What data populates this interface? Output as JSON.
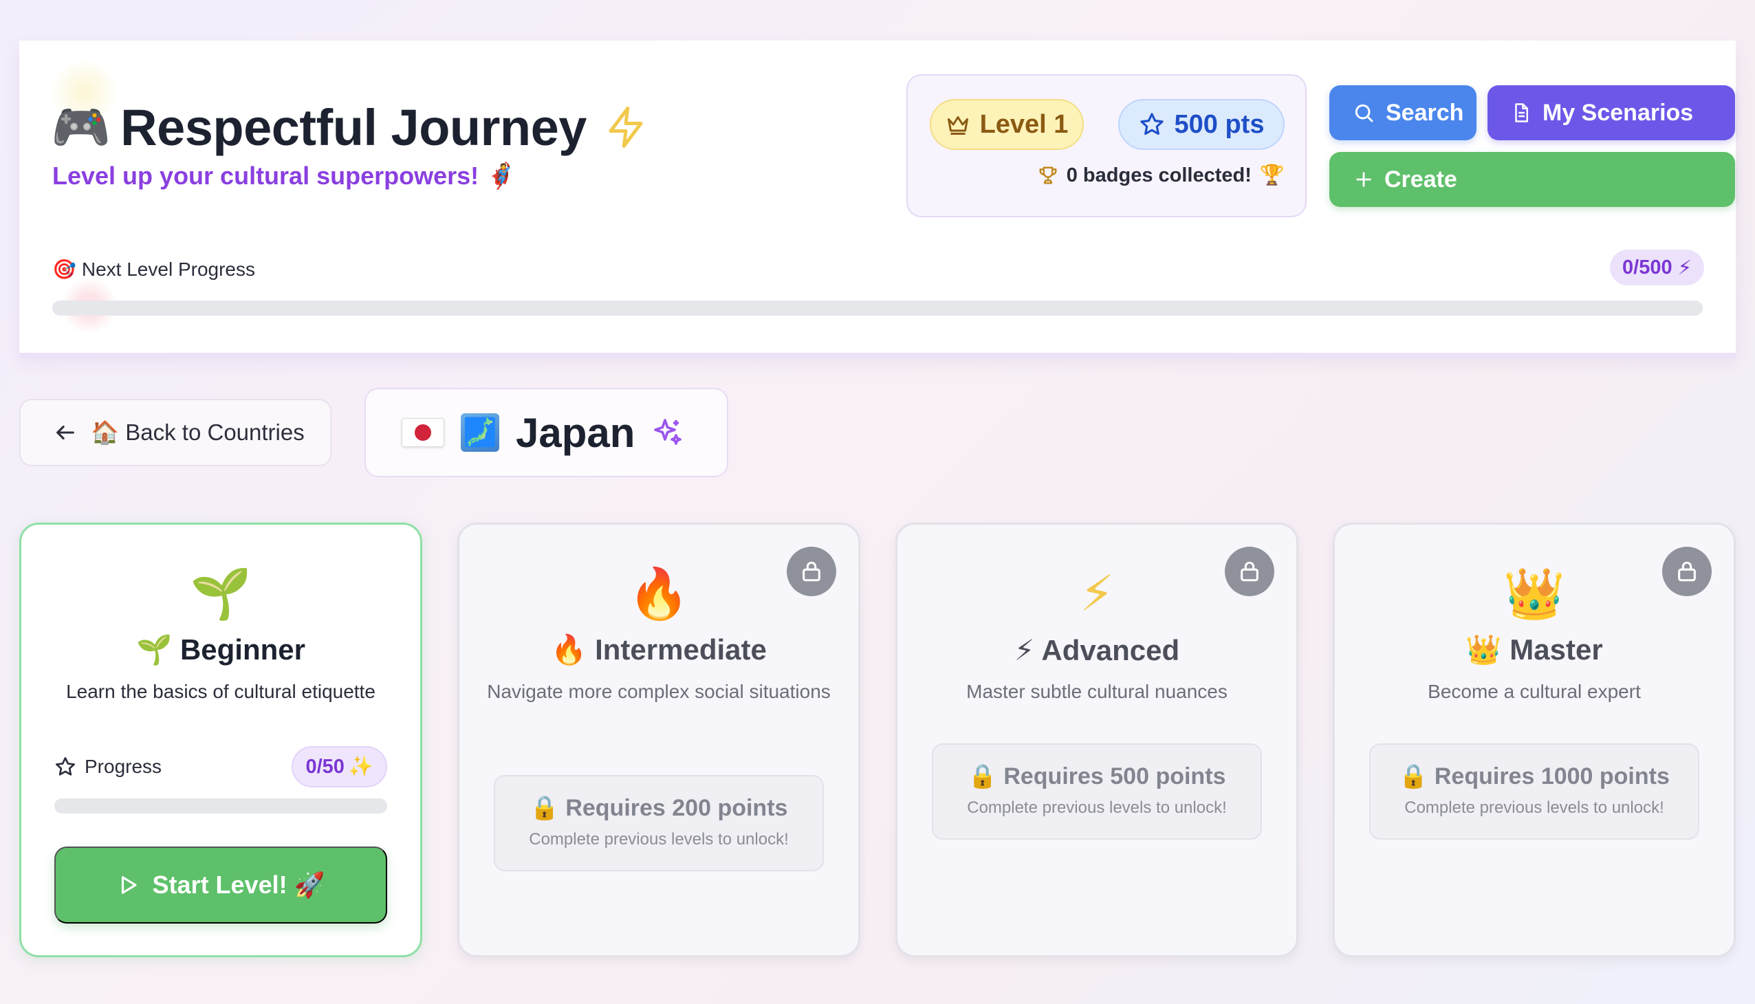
{
  "header": {
    "title_emoji": "🎮",
    "title": "Respectful Journey",
    "subtitle": "Level up your cultural superpowers!",
    "subtitle_emoji": "🦸",
    "level_label": "Level 1",
    "points_label": "500 pts",
    "badges_text": "0 badges collected!",
    "badges_emoji": "🏆",
    "buttons": {
      "search": "Search",
      "scenarios": "My Scenarios",
      "create": "Create"
    },
    "progress": {
      "label_emoji": "🎯",
      "label": "Next Level Progress",
      "count": "0/500",
      "count_emoji": "⚡",
      "value": 0
    }
  },
  "nav": {
    "back_emoji": "🏠",
    "back_label": "Back to Countries",
    "map_emoji": "🗾",
    "country": "Japan"
  },
  "levels": [
    {
      "icon": "🌱",
      "title": "🌱 Beginner",
      "description": "Learn the basics of cultural etiquette",
      "locked": false,
      "progress_label": "Progress",
      "progress_count": "0/50",
      "progress_emoji": "✨",
      "progress_value": 0,
      "start_label": "Start Level!",
      "start_emoji": "🚀"
    },
    {
      "icon": "🔥",
      "title": "🔥 Intermediate",
      "description": "Navigate more complex social situations",
      "locked": true,
      "requirement": "🔒 Requires 200 points",
      "requirement_sub": "Complete previous levels to unlock!"
    },
    {
      "icon": "⚡",
      "title": "⚡ Advanced",
      "description": "Master subtle cultural nuances",
      "locked": true,
      "requirement": "🔒 Requires 500 points",
      "requirement_sub": "Complete previous levels to unlock!"
    },
    {
      "icon": "👑",
      "title": "👑 Master",
      "description": "Become a cultural expert",
      "locked": true,
      "requirement": "🔒 Requires 1000 points",
      "requirement_sub": "Complete previous levels to unlock!"
    }
  ],
  "colors": {
    "accent_purple": "#8a3fe0",
    "search_blue": "#4b86ec",
    "scenarios_indigo": "#6b58e8",
    "create_green": "#5ec06a",
    "level_gold": "#fdf2b8",
    "points_blue": "#dceafd"
  }
}
